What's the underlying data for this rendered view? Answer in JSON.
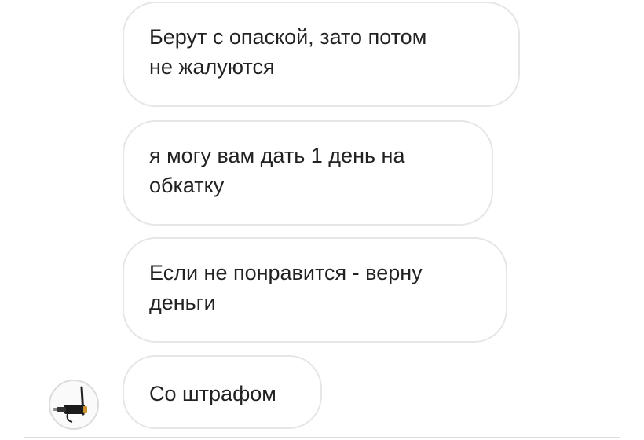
{
  "messages": [
    {
      "text": "Берут с опаской, зато потом\nне жалуются"
    },
    {
      "text": "я могу вам дать 1 день на\nобкатку"
    },
    {
      "text": "Если не понравится - верну\nденьги"
    },
    {
      "text": "Со штрафом"
    }
  ],
  "avatar": {
    "icon": "car-charger-device-icon"
  },
  "colors": {
    "bubble_border": "#e6e6e6",
    "text": "#222222",
    "background": "#ffffff"
  }
}
